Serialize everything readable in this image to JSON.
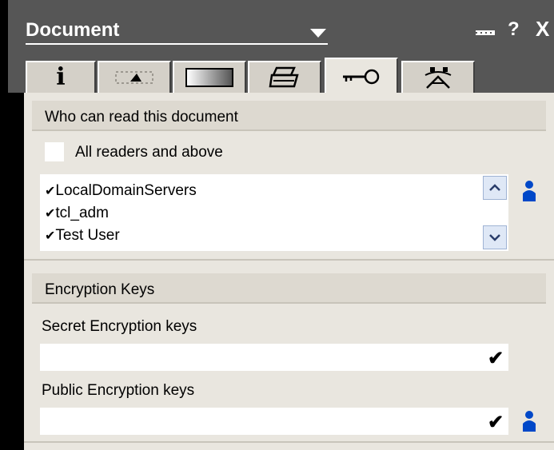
{
  "title_bar": {
    "title": "Document",
    "icons": [
      "dropdown-arrow-icon",
      "minimize-icon",
      "help-icon",
      "close-icon"
    ],
    "help_glyph": "?",
    "close_glyph": "X"
  },
  "tabs": [
    {
      "icon": "info-icon",
      "glyph": "i"
    },
    {
      "icon": "field-icon"
    },
    {
      "icon": "gradient-icon"
    },
    {
      "icon": "printer-icon"
    },
    {
      "icon": "key-icon",
      "active": true
    },
    {
      "icon": "network-icon"
    }
  ],
  "readers_section": {
    "header": "Who can read this document",
    "all_readers_label": "All readers and above",
    "all_readers_checked": false,
    "readers": [
      "LocalDomainServers",
      "tcl_adm",
      "Test User"
    ],
    "check_glyph": "✔"
  },
  "encryption_section": {
    "header": "Encryption Keys",
    "secret_label": "Secret Encryption keys",
    "secret_value": "",
    "public_label": "Public Encryption keys",
    "public_value": ""
  },
  "colors": {
    "titlebar": "#565656",
    "panel": "#e9e6df",
    "header": "#ddd9d0",
    "person_icon": "#0048c8"
  }
}
